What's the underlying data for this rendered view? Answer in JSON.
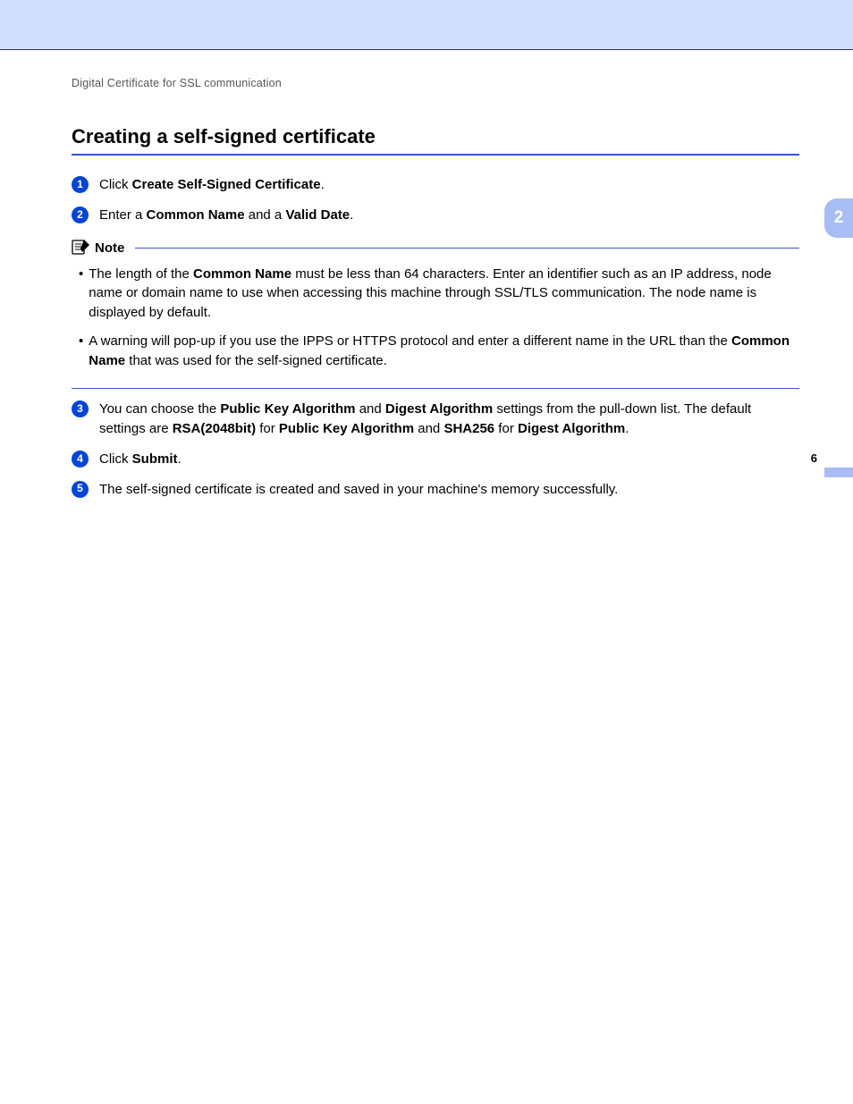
{
  "header": {
    "breadcrumb": "Digital Certificate for SSL communication",
    "title": "Creating a self-signed certificate"
  },
  "chapter_tab": "2",
  "page_number": "6",
  "steps": {
    "s1": {
      "num": "1",
      "pre": "Click ",
      "b1": "Create Self-Signed Certificate",
      "post": "."
    },
    "s2": {
      "num": "2",
      "pre": "Enter a ",
      "b1": "Common Name",
      "mid": " and a ",
      "b2": "Valid Date",
      "post": "."
    },
    "s3": {
      "num": "3",
      "pre": "You can choose the ",
      "b1": "Public Key Algorithm",
      "mid1": " and ",
      "b2": "Digest Algorithm",
      "mid2": " settings from the pull-down list. The default settings are ",
      "b3": "RSA(2048bit)",
      "mid3": " for ",
      "b4": "Public Key Algorithm",
      "mid4": " and ",
      "b5": "SHA256",
      "mid5": " for ",
      "b6": "Digest Algorithm",
      "post": "."
    },
    "s4": {
      "num": "4",
      "pre": "Click ",
      "b1": "Submit",
      "post": "."
    },
    "s5": {
      "num": "5",
      "text": "The self-signed certificate is created and saved in your machine's memory successfully."
    }
  },
  "note": {
    "label": "Note",
    "b1": {
      "pre": "The length of the ",
      "bold": "Common Name",
      "post": " must be less than 64 characters. Enter an identifier such as an IP address, node name or domain name to use when accessing this machine through SSL/TLS communication. The node name is displayed by default."
    },
    "b2": {
      "pre": "A warning will pop-up if you use the IPPS or HTTPS protocol and enter a different name in the URL than the ",
      "bold": "Common Name",
      "post": " that was used for the self-signed certificate."
    }
  }
}
